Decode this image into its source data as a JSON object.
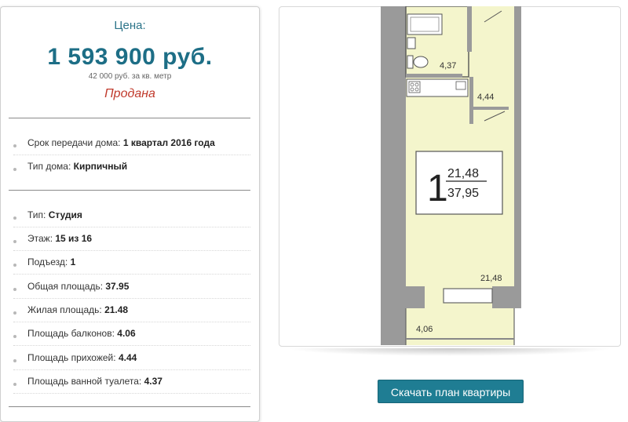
{
  "price": {
    "label": "Цена:",
    "value": "1 593 900 руб.",
    "per_meter": "42 000 руб. за кв. метр",
    "status": "Продана"
  },
  "house_info": [
    {
      "label": "Срок передачи дома:",
      "value": "1 квартал 2016 года"
    },
    {
      "label": "Тип дома:",
      "value": "Кирпичный"
    }
  ],
  "apartment_info": [
    {
      "label": "Тип:",
      "value": "Студия"
    },
    {
      "label": "Этаж:",
      "value": "15 из 16"
    },
    {
      "label": "Подъезд:",
      "value": "1"
    },
    {
      "label": "Общая площадь:",
      "value": "37.95"
    },
    {
      "label": "Жилая площадь:",
      "value": "21.48"
    },
    {
      "label": "Площадь балконов:",
      "value": "4.06"
    },
    {
      "label": "Площадь прихожей:",
      "value": "4.44"
    },
    {
      "label": "Площадь ванной туалета:",
      "value": "4.37"
    }
  ],
  "plan": {
    "rooms_count": "1",
    "living_area": "21,48",
    "total_area": "37,95",
    "bathroom_area": "4,37",
    "hallway_area": "4,44",
    "room_area": "21,48",
    "balcony_area": "4,06"
  },
  "download_button": "Скачать план квартиры"
}
